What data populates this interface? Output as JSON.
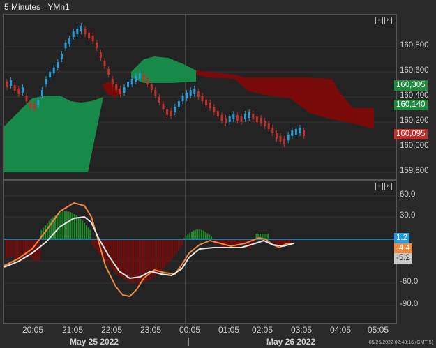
{
  "chart_title": "5 Minutes =YMn1",
  "price_axis": [
    "160,800",
    "160,600",
    "160,400",
    "160,200",
    "160,000",
    "159,800"
  ],
  "price_tags": [
    {
      "label": "160,305",
      "color": "#1e8a3e"
    },
    {
      "label": "160,140",
      "color": "#1e8a3e"
    },
    {
      "label": "160,095",
      "color": "#c0302c"
    }
  ],
  "osc_axis": [
    "60.0",
    "30.0",
    "-60.0",
    "-90.0"
  ],
  "osc_tags": [
    {
      "label": "1.2",
      "color": "#2a9ad8"
    },
    {
      "label": "-4.4",
      "color": "#f0883e"
    },
    {
      "label": "-5.2",
      "color": "#c8c8c8"
    }
  ],
  "time_axis": [
    "20:05",
    "21:05",
    "22:05",
    "23:05",
    "00:05",
    "01:05",
    "02:05",
    "03:05",
    "04:05",
    "05:05"
  ],
  "dates": [
    "May 25 2022",
    "May 26 2022"
  ],
  "timestamp": "05/26/2022 02:48:16  (GMT-5)",
  "colors": {
    "up": "#2a9ad8",
    "down": "#c0302c",
    "cloud_green": "#178a4a",
    "cloud_red": "#7a0a0a",
    "bg": "#232323"
  },
  "icons": [
    "restore-icon",
    "close-icon"
  ]
}
